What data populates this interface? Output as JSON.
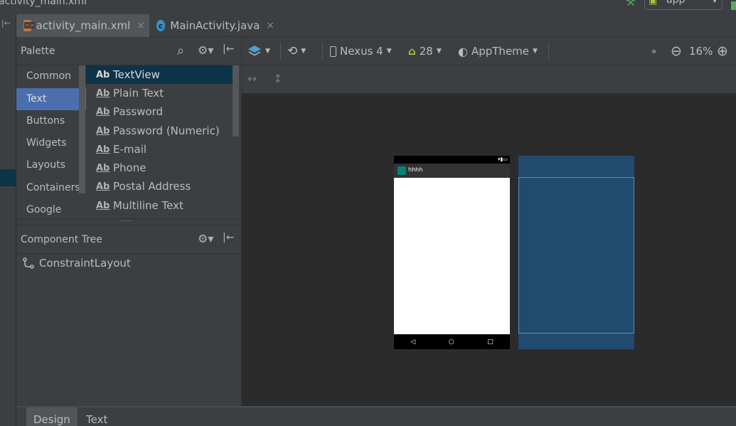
{
  "top": {
    "crumb": "activity_main.xml",
    "run_config": "app"
  },
  "tabs": [
    {
      "label": "activity_main.xml",
      "close": "×"
    },
    {
      "label": "MainActivity.java",
      "close": "×",
      "icon_letter": "c"
    }
  ],
  "palette": {
    "title": "Palette",
    "categories": [
      "Common",
      "Text",
      "Buttons",
      "Widgets",
      "Layouts",
      "Containers",
      "Google"
    ],
    "selected_category": "Text",
    "item_icon": "Ab",
    "items": [
      "TextView",
      "Plain Text",
      "Password",
      "Password (Numeric)",
      "E-mail",
      "Phone",
      "Postal Address",
      "Multiline Text"
    ],
    "selected_item": "TextView"
  },
  "component_tree": {
    "title": "Component Tree",
    "root": "ConstraintLayout"
  },
  "design_toolbar": {
    "device": "Nexus 4",
    "api_level": "28",
    "theme": "AppTheme",
    "zoom": "16%",
    "more": "»"
  },
  "preview": {
    "app_title": "hhhh"
  },
  "editor_tabs": [
    "Design",
    "Text"
  ],
  "colors": {
    "accent_selected": "#4b6eaf",
    "blueprint": "#214a6f",
    "android_green": "#a4c639"
  }
}
